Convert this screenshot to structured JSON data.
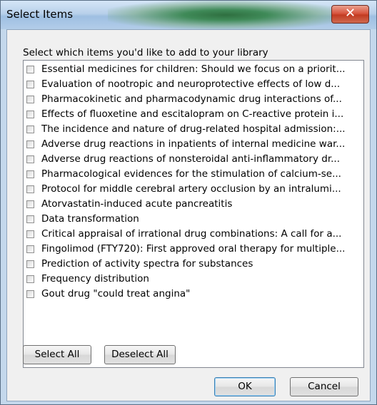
{
  "window": {
    "title": "Select Items",
    "close_glyph": "✕"
  },
  "dialog": {
    "prompt": "Select which items you'd like to add to your library",
    "items": [
      {
        "label": "Essential medicines for children: Should we focus on a priorit...",
        "checked": false
      },
      {
        "label": "Evaluation of nootropic and neuroprotective effects of low d...",
        "checked": false
      },
      {
        "label": "Pharmacokinetic and pharmacodynamic drug interactions of...",
        "checked": false
      },
      {
        "label": "Effects of fluoxetine and escitalopram on C-reactive protein i...",
        "checked": false
      },
      {
        "label": "The incidence and nature of drug-related hospital admission:...",
        "checked": false
      },
      {
        "label": "Adverse drug reactions in inpatients of internal medicine war...",
        "checked": false
      },
      {
        "label": "Adverse drug reactions of nonsteroidal anti-inflammatory dr...",
        "checked": false
      },
      {
        "label": "Pharmacological evidences for the stimulation of calcium-se...",
        "checked": false
      },
      {
        "label": "Protocol for middle cerebral artery occlusion by an intralumi...",
        "checked": false
      },
      {
        "label": "Atorvastatin-induced acute pancreatitis",
        "checked": false
      },
      {
        "label": "Data transformation",
        "checked": false
      },
      {
        "label": "Critical appraisal of irrational drug combinations: A call for a...",
        "checked": false
      },
      {
        "label": "Fingolimod (FTY720): First approved oral therapy for multiple...",
        "checked": false
      },
      {
        "label": "Prediction of activity spectra for substances",
        "checked": false
      },
      {
        "label": "Frequency distribution",
        "checked": false
      },
      {
        "label": "Gout drug \"could treat angina\"",
        "checked": false
      }
    ],
    "select_all_label": "Select All",
    "deselect_all_label": "Deselect All",
    "ok_label": "OK",
    "cancel_label": "Cancel"
  }
}
